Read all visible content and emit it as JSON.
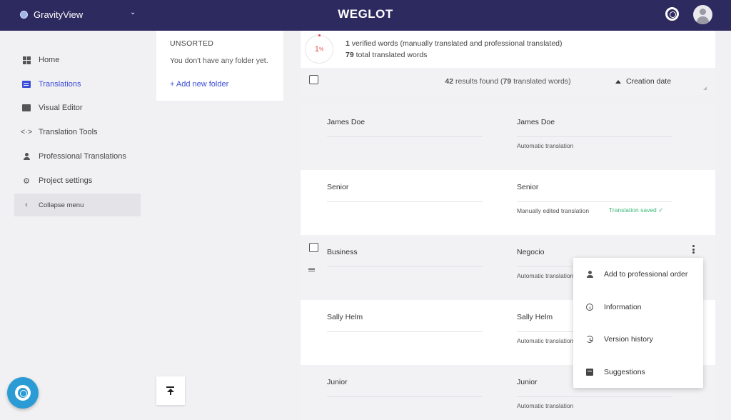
{
  "header": {
    "project_name": "GravityView",
    "logo_text": "WEGLOT"
  },
  "sidebar": {
    "items": [
      {
        "label": "Home",
        "icon": "dashboard-icon"
      },
      {
        "label": "Translations",
        "icon": "translations-icon",
        "active": true
      },
      {
        "label": "Visual Editor",
        "icon": "visual-editor-icon"
      },
      {
        "label": "Translation Tools",
        "icon": "code-icon"
      },
      {
        "label": "Professional Translations",
        "icon": "person-icon"
      },
      {
        "label": "Project settings",
        "icon": "gear-icon"
      }
    ],
    "collapse_label": "Collapse menu"
  },
  "folders": {
    "title": "UNSORTED",
    "empty_text": "You don't have any folder yet.",
    "add_label": "+ Add new folder"
  },
  "stats": {
    "percent": "1",
    "percent_unit": "%",
    "verified_count": "1",
    "verified_text": " verified words (manually translated and professional translated)",
    "total_count": "79",
    "total_text": " total translated words"
  },
  "toolbar": {
    "results_count": "42",
    "results_text": " results found (",
    "results_words": "79",
    "results_suffix": " translated words)",
    "sort_label": "Creation date"
  },
  "rows": [
    {
      "source": "James Doe",
      "target": "James Doe",
      "status": "Automatic translation",
      "saved": ""
    },
    {
      "source": "Senior",
      "target": "Senior",
      "status": "Manually edited translation",
      "saved": "Translation saved ✓"
    },
    {
      "source": "Business",
      "target": "Negocio",
      "status": "Automatic translation",
      "saved": ""
    },
    {
      "source": "Sally Helm",
      "target": "Sally Helm",
      "status": "Automatic translation",
      "saved": ""
    },
    {
      "source": "Junior",
      "target": "Junior",
      "status": "Automatic translation",
      "saved": ""
    }
  ],
  "context_menu": {
    "items": [
      {
        "label": "Add to professional order",
        "icon": "person-icon"
      },
      {
        "label": "Information",
        "icon": "info-icon"
      },
      {
        "label": "Version history",
        "icon": "history-icon"
      },
      {
        "label": "Suggestions",
        "icon": "comment-icon"
      }
    ]
  },
  "colors": {
    "topbar": "#2d2a5f",
    "accent": "#3b4dd6",
    "success": "#3cb878",
    "percent": "#e54848",
    "help_fab": "#2a9bd4"
  }
}
